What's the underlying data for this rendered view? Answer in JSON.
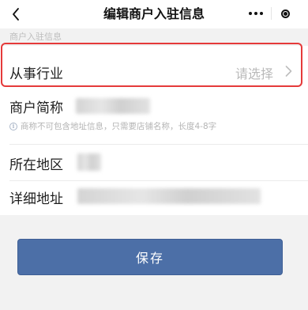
{
  "navbar": {
    "title": "编辑商户入驻信息",
    "back_icon": "chevron-left-icon",
    "menu_icon": "more-dots-icon",
    "close_icon": "target-circle-icon"
  },
  "section": {
    "header": "商户入驻信息"
  },
  "form": {
    "industry": {
      "label": "从事行业",
      "placeholder": "请选择",
      "icon": "chevron-right-icon",
      "highlight_color": "#e53a3a"
    },
    "short_name": {
      "label": "商户简称",
      "value": "",
      "value_state": "blurred",
      "hint": "商称不可包含地址信息，只需要店铺名称，长度4-8字",
      "hint_icon": "info-circle-icon"
    },
    "region": {
      "label": "所在地区",
      "value": "",
      "value_state": "blurred"
    },
    "address": {
      "label": "详细地址",
      "value": "",
      "value_state": "blurred"
    }
  },
  "actions": {
    "save_label": "保存",
    "save_color": "#4c6fa7"
  }
}
